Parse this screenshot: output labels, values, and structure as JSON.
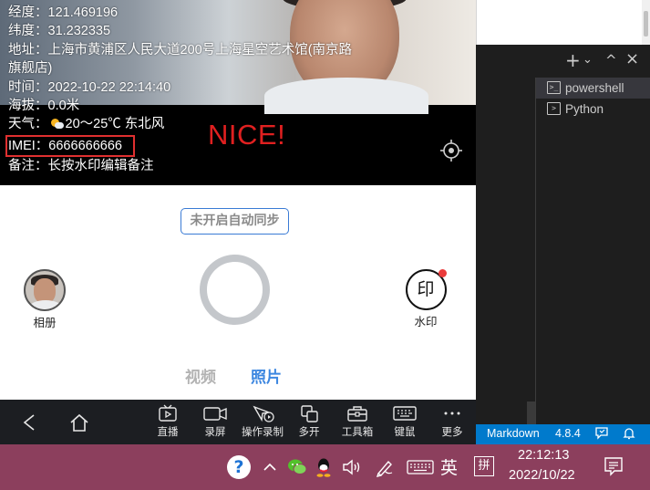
{
  "watermark": {
    "longitude": "经度：121.469196",
    "latitude": "纬度：31.232335",
    "address": "地址：上海市黄浦区人民大道200号上海星空艺术馆(南京路旗舰店)",
    "time": "时间：2022-10-22 22:14:40",
    "altitude": "海拔：0.0米",
    "weather_prefix": "天气：",
    "weather_value": "20～25℃ 东北风",
    "imei": "IMEI：6666666666",
    "note": "备注：长按水印编辑备注"
  },
  "overlay_text": "NICE!",
  "camera": {
    "sync_badge": "未开启自动同步",
    "album_label": "相册",
    "stamp_glyph": "印",
    "stamp_label": "水印",
    "mode_video": "视频",
    "mode_photo": "照片",
    "active_mode": "照片"
  },
  "phone_toolbar": {
    "items": [
      {
        "icon": "play-screen-icon",
        "label": "直播"
      },
      {
        "icon": "camera-record-icon",
        "label": "录屏"
      },
      {
        "icon": "macro-record-icon",
        "label": "操作录制"
      },
      {
        "icon": "multi-open-icon",
        "label": "多开"
      },
      {
        "icon": "toolbox-icon",
        "label": "工具箱"
      },
      {
        "icon": "keyboard-icon",
        "label": "键鼠"
      },
      {
        "icon": "more-icon",
        "label": "更多"
      }
    ]
  },
  "vscode": {
    "actions": [
      "+",
      "⌄",
      "^",
      "×"
    ],
    "terminals": [
      {
        "name": "powershell",
        "active": true
      },
      {
        "name": "Python",
        "active": false
      }
    ],
    "status": {
      "language": "Markdown",
      "version": "4.8.4"
    }
  },
  "taskbar": {
    "help": "?",
    "language": "英",
    "ime": "拼",
    "time": "22:12:13",
    "date": "2022/10/22"
  },
  "colors": {
    "accent_blue": "#3d87e0",
    "annotation_red": "#e02020",
    "taskbar": "#8c3f5d",
    "vscode_status": "#007acc"
  }
}
